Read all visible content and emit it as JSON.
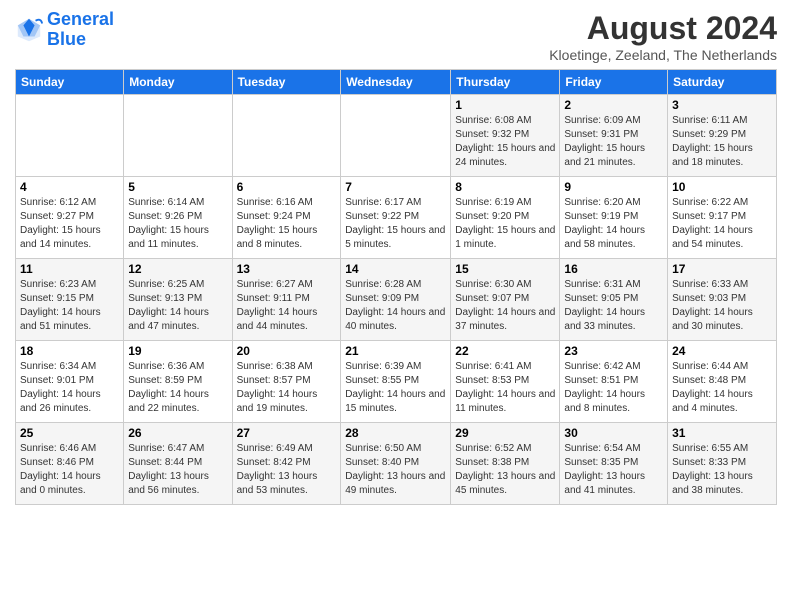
{
  "logo": {
    "line1": "General",
    "line2": "Blue"
  },
  "title": "August 2024",
  "location": "Kloetinge, Zeeland, The Netherlands",
  "weekdays": [
    "Sunday",
    "Monday",
    "Tuesday",
    "Wednesday",
    "Thursday",
    "Friday",
    "Saturday"
  ],
  "weeks": [
    [
      {
        "day": "",
        "sunrise": "",
        "sunset": "",
        "daylight": ""
      },
      {
        "day": "",
        "sunrise": "",
        "sunset": "",
        "daylight": ""
      },
      {
        "day": "",
        "sunrise": "",
        "sunset": "",
        "daylight": ""
      },
      {
        "day": "",
        "sunrise": "",
        "sunset": "",
        "daylight": ""
      },
      {
        "day": "1",
        "sunrise": "Sunrise: 6:08 AM",
        "sunset": "Sunset: 9:32 PM",
        "daylight": "Daylight: 15 hours and 24 minutes."
      },
      {
        "day": "2",
        "sunrise": "Sunrise: 6:09 AM",
        "sunset": "Sunset: 9:31 PM",
        "daylight": "Daylight: 15 hours and 21 minutes."
      },
      {
        "day": "3",
        "sunrise": "Sunrise: 6:11 AM",
        "sunset": "Sunset: 9:29 PM",
        "daylight": "Daylight: 15 hours and 18 minutes."
      }
    ],
    [
      {
        "day": "4",
        "sunrise": "Sunrise: 6:12 AM",
        "sunset": "Sunset: 9:27 PM",
        "daylight": "Daylight: 15 hours and 14 minutes."
      },
      {
        "day": "5",
        "sunrise": "Sunrise: 6:14 AM",
        "sunset": "Sunset: 9:26 PM",
        "daylight": "Daylight: 15 hours and 11 minutes."
      },
      {
        "day": "6",
        "sunrise": "Sunrise: 6:16 AM",
        "sunset": "Sunset: 9:24 PM",
        "daylight": "Daylight: 15 hours and 8 minutes."
      },
      {
        "day": "7",
        "sunrise": "Sunrise: 6:17 AM",
        "sunset": "Sunset: 9:22 PM",
        "daylight": "Daylight: 15 hours and 5 minutes."
      },
      {
        "day": "8",
        "sunrise": "Sunrise: 6:19 AM",
        "sunset": "Sunset: 9:20 PM",
        "daylight": "Daylight: 15 hours and 1 minute."
      },
      {
        "day": "9",
        "sunrise": "Sunrise: 6:20 AM",
        "sunset": "Sunset: 9:19 PM",
        "daylight": "Daylight: 14 hours and 58 minutes."
      },
      {
        "day": "10",
        "sunrise": "Sunrise: 6:22 AM",
        "sunset": "Sunset: 9:17 PM",
        "daylight": "Daylight: 14 hours and 54 minutes."
      }
    ],
    [
      {
        "day": "11",
        "sunrise": "Sunrise: 6:23 AM",
        "sunset": "Sunset: 9:15 PM",
        "daylight": "Daylight: 14 hours and 51 minutes."
      },
      {
        "day": "12",
        "sunrise": "Sunrise: 6:25 AM",
        "sunset": "Sunset: 9:13 PM",
        "daylight": "Daylight: 14 hours and 47 minutes."
      },
      {
        "day": "13",
        "sunrise": "Sunrise: 6:27 AM",
        "sunset": "Sunset: 9:11 PM",
        "daylight": "Daylight: 14 hours and 44 minutes."
      },
      {
        "day": "14",
        "sunrise": "Sunrise: 6:28 AM",
        "sunset": "Sunset: 9:09 PM",
        "daylight": "Daylight: 14 hours and 40 minutes."
      },
      {
        "day": "15",
        "sunrise": "Sunrise: 6:30 AM",
        "sunset": "Sunset: 9:07 PM",
        "daylight": "Daylight: 14 hours and 37 minutes."
      },
      {
        "day": "16",
        "sunrise": "Sunrise: 6:31 AM",
        "sunset": "Sunset: 9:05 PM",
        "daylight": "Daylight: 14 hours and 33 minutes."
      },
      {
        "day": "17",
        "sunrise": "Sunrise: 6:33 AM",
        "sunset": "Sunset: 9:03 PM",
        "daylight": "Daylight: 14 hours and 30 minutes."
      }
    ],
    [
      {
        "day": "18",
        "sunrise": "Sunrise: 6:34 AM",
        "sunset": "Sunset: 9:01 PM",
        "daylight": "Daylight: 14 hours and 26 minutes."
      },
      {
        "day": "19",
        "sunrise": "Sunrise: 6:36 AM",
        "sunset": "Sunset: 8:59 PM",
        "daylight": "Daylight: 14 hours and 22 minutes."
      },
      {
        "day": "20",
        "sunrise": "Sunrise: 6:38 AM",
        "sunset": "Sunset: 8:57 PM",
        "daylight": "Daylight: 14 hours and 19 minutes."
      },
      {
        "day": "21",
        "sunrise": "Sunrise: 6:39 AM",
        "sunset": "Sunset: 8:55 PM",
        "daylight": "Daylight: 14 hours and 15 minutes."
      },
      {
        "day": "22",
        "sunrise": "Sunrise: 6:41 AM",
        "sunset": "Sunset: 8:53 PM",
        "daylight": "Daylight: 14 hours and 11 minutes."
      },
      {
        "day": "23",
        "sunrise": "Sunrise: 6:42 AM",
        "sunset": "Sunset: 8:51 PM",
        "daylight": "Daylight: 14 hours and 8 minutes."
      },
      {
        "day": "24",
        "sunrise": "Sunrise: 6:44 AM",
        "sunset": "Sunset: 8:48 PM",
        "daylight": "Daylight: 14 hours and 4 minutes."
      }
    ],
    [
      {
        "day": "25",
        "sunrise": "Sunrise: 6:46 AM",
        "sunset": "Sunset: 8:46 PM",
        "daylight": "Daylight: 14 hours and 0 minutes."
      },
      {
        "day": "26",
        "sunrise": "Sunrise: 6:47 AM",
        "sunset": "Sunset: 8:44 PM",
        "daylight": "Daylight: 13 hours and 56 minutes."
      },
      {
        "day": "27",
        "sunrise": "Sunrise: 6:49 AM",
        "sunset": "Sunset: 8:42 PM",
        "daylight": "Daylight: 13 hours and 53 minutes."
      },
      {
        "day": "28",
        "sunrise": "Sunrise: 6:50 AM",
        "sunset": "Sunset: 8:40 PM",
        "daylight": "Daylight: 13 hours and 49 minutes."
      },
      {
        "day": "29",
        "sunrise": "Sunrise: 6:52 AM",
        "sunset": "Sunset: 8:38 PM",
        "daylight": "Daylight: 13 hours and 45 minutes."
      },
      {
        "day": "30",
        "sunrise": "Sunrise: 6:54 AM",
        "sunset": "Sunset: 8:35 PM",
        "daylight": "Daylight: 13 hours and 41 minutes."
      },
      {
        "day": "31",
        "sunrise": "Sunrise: 6:55 AM",
        "sunset": "Sunset: 8:33 PM",
        "daylight": "Daylight: 13 hours and 38 minutes."
      }
    ]
  ]
}
